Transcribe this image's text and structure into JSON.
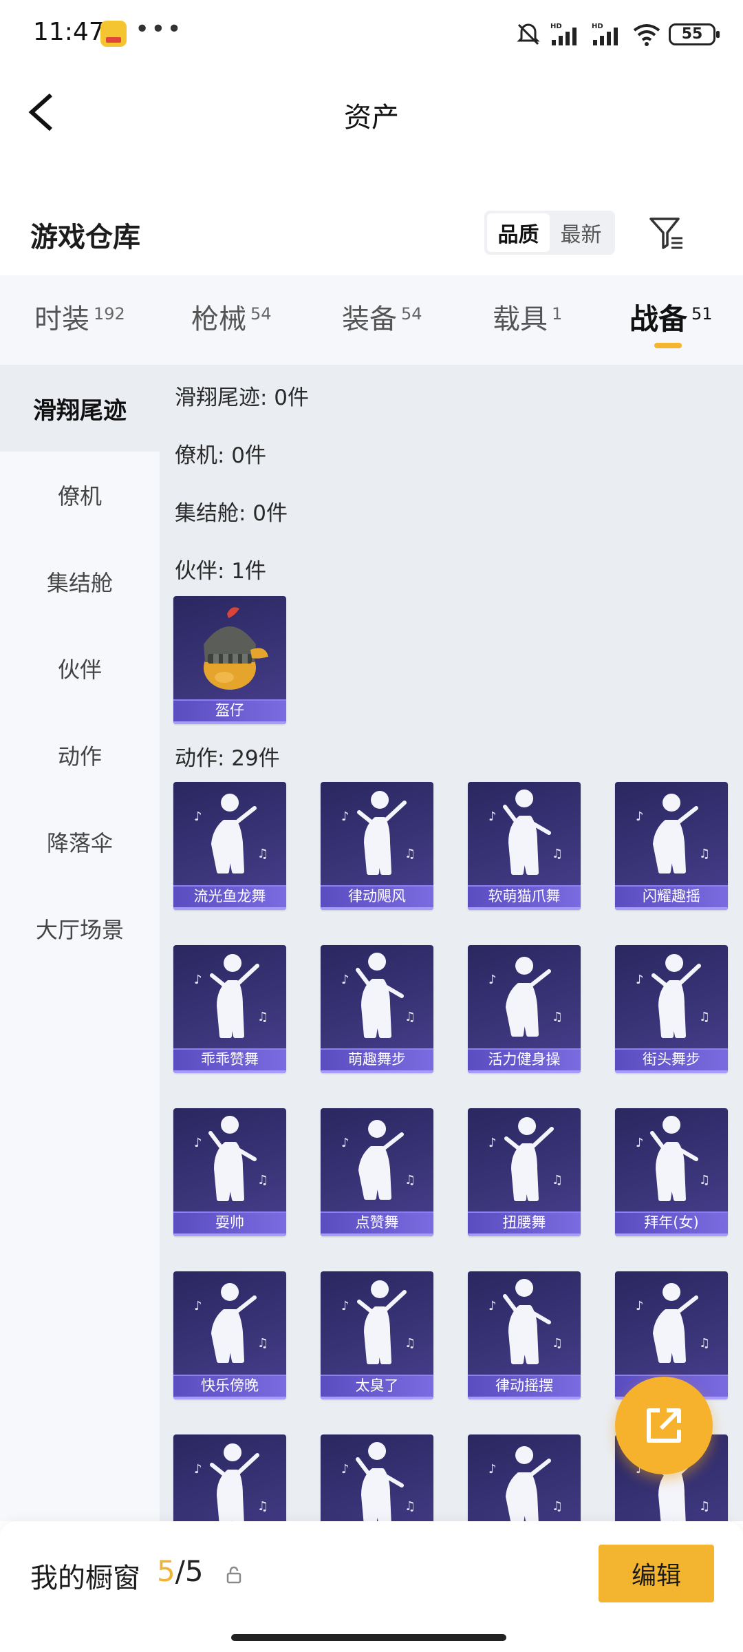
{
  "status_bar": {
    "time": "11:47",
    "battery": "55",
    "hd_label": "HD"
  },
  "header": {
    "title": "资产"
  },
  "warehouse": {
    "title": "游戏仓库",
    "sort_options": [
      "品质",
      "最新"
    ],
    "active_sort": "品质"
  },
  "tabs": [
    {
      "label": "时装",
      "count": "192"
    },
    {
      "label": "枪械",
      "count": "54"
    },
    {
      "label": "装备",
      "count": "54"
    },
    {
      "label": "载具",
      "count": "1"
    },
    {
      "label": "战备",
      "count": "51"
    }
  ],
  "active_tab": "战备",
  "side_nav": [
    "滑翔尾迹",
    "僚机",
    "集结舱",
    "伙伴",
    "动作",
    "降落伞",
    "大厅场景"
  ],
  "active_side": "滑翔尾迹",
  "groups": [
    {
      "label": "滑翔尾迹: 0件"
    },
    {
      "label": "僚机: 0件"
    },
    {
      "label": "集结舱: 0件"
    },
    {
      "label": "伙伴: 1件"
    },
    {
      "label": "动作: 29件"
    }
  ],
  "partner_items": [
    "盔仔"
  ],
  "action_items": [
    "流光鱼龙舞",
    "律动飓风",
    "软萌猫爪舞",
    "闪耀趣摇",
    "乖乖赞舞",
    "萌趣舞步",
    "活力健身操",
    "街头舞步",
    "耍帅",
    "点赞舞",
    "扭腰舞",
    "拜年(女)",
    "快乐傍晚",
    "太臭了",
    "律动摇摆",
    "",
    "",
    "",
    "",
    ""
  ],
  "bottom_bar": {
    "showcase_label": "我的橱窗",
    "showcase_current": "5",
    "showcase_sep": "/",
    "showcase_total": "5",
    "edit_label": "编辑"
  },
  "colors": {
    "accent": "#f3b52f",
    "card_bg": "#2f2b68",
    "card_strip": "#6a5bd6"
  }
}
